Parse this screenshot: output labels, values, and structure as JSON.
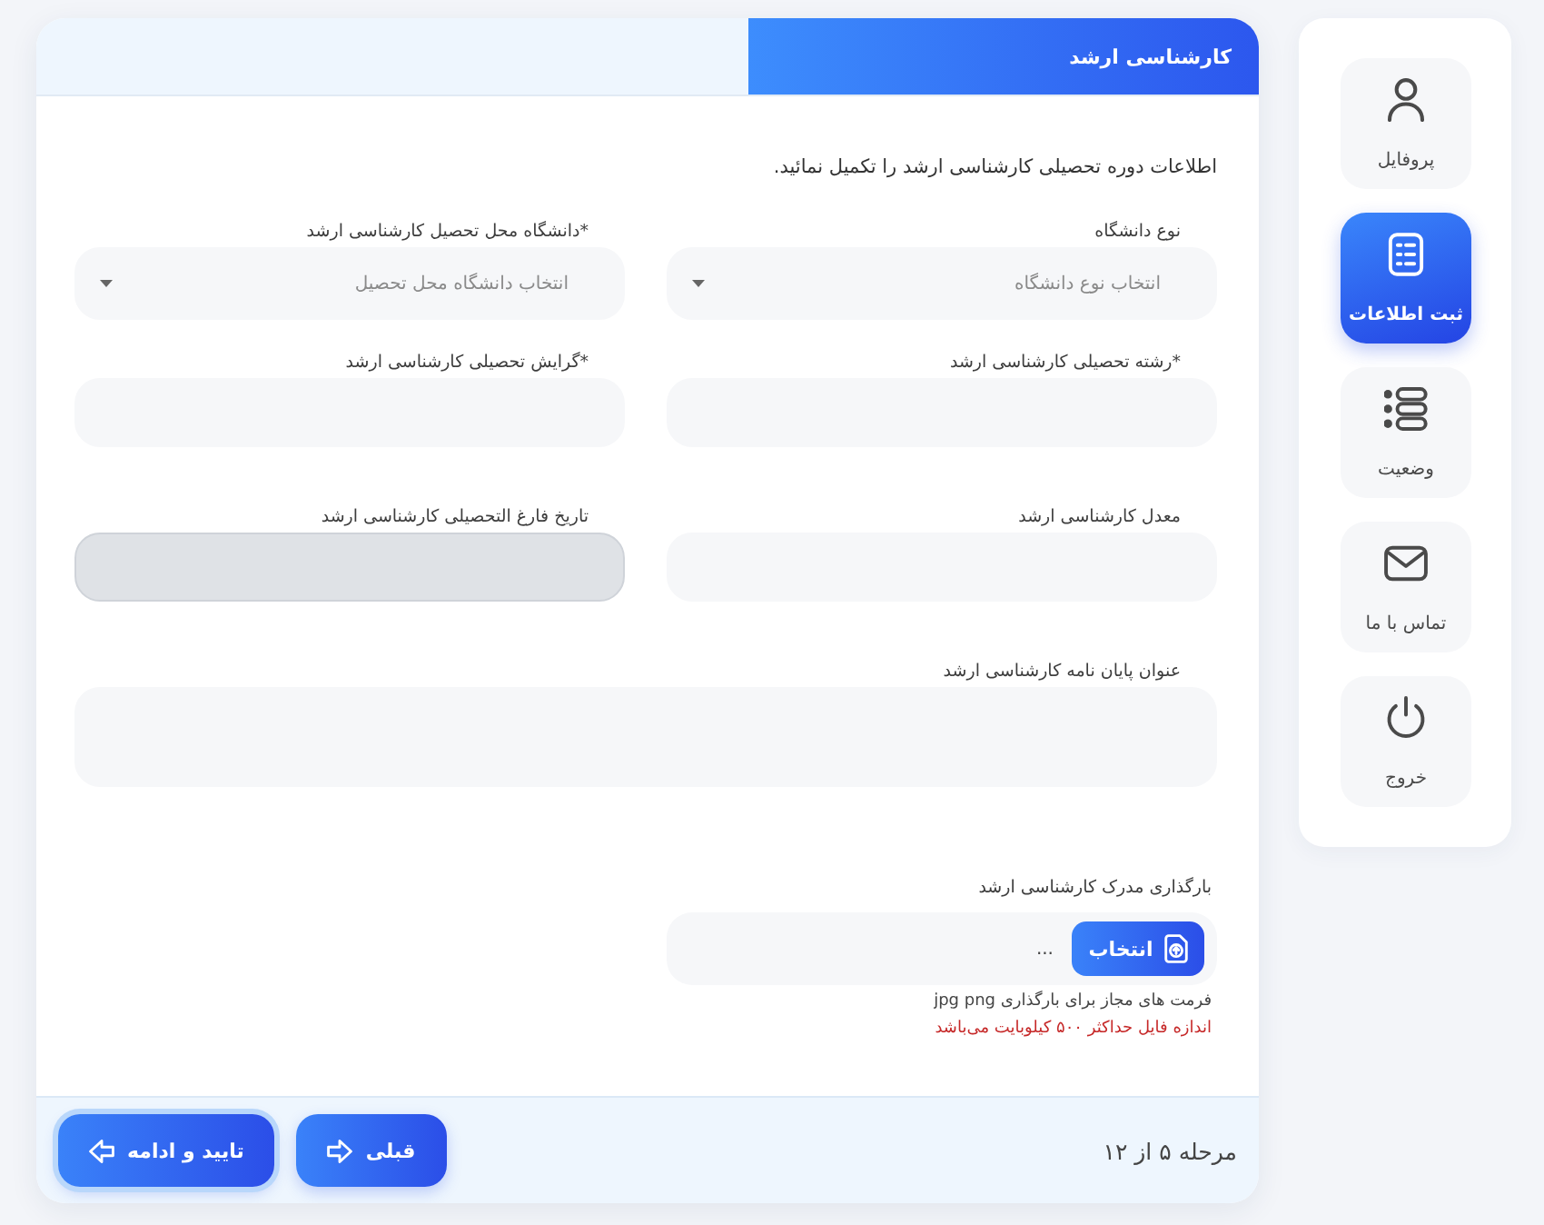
{
  "sidebar": {
    "items": [
      {
        "label": "پروفایل",
        "selected": false
      },
      {
        "label": "ثبت اطلاعات",
        "selected": true
      },
      {
        "label": "وضعیت",
        "selected": false
      },
      {
        "label": "تماس با ما",
        "selected": false
      },
      {
        "label": "خروج",
        "selected": false
      }
    ]
  },
  "card": {
    "title": "کارشناسی ارشد",
    "intro": "اطلاعات دوره تحصیلی کارشناسی ارشد را تکمیل نمائید.",
    "rows": [
      {
        "fields": [
          {
            "kind": "select",
            "label": "نوع دانشگاه",
            "placeholder": "انتخاب نوع دانشگاه",
            "disabled": false
          },
          {
            "kind": "select",
            "label": "*دانشگاه محل تحصیل کارشناسی ارشد",
            "placeholder": "انتخاب دانشگاه محل تحصیل",
            "disabled": false
          }
        ]
      },
      {
        "fields": [
          {
            "kind": "text",
            "label": "*رشته تحصیلی کارشناسی ارشد",
            "disabled": false
          },
          {
            "kind": "text",
            "label": "*گرایش تحصیلی کارشناسی ارشد",
            "disabled": false
          }
        ]
      },
      {
        "fields": [
          {
            "kind": "text",
            "label": "معدل کارشناسی ارشد",
            "disabled": false
          },
          {
            "kind": "text",
            "label": "تاریخ فارغ التحصیلی کارشناسی ارشد",
            "disabled": true
          }
        ]
      },
      {
        "fields": [
          {
            "kind": "textarea",
            "label": "عنوان پایان نامه کارشناسی ارشد",
            "disabled": false
          }
        ]
      }
    ],
    "upload": {
      "label": "بارگذاری مدرک کارشناسی ارشد",
      "button": "انتخاب",
      "file_name": "...",
      "formats": "فرمت های مجاز برای بارگذاری jpg png",
      "size_note": "اندازه فایل حداکثر ۵۰۰ کیلوبایت می‌باشد"
    },
    "footer": {
      "step": "مرحله ۵ از ۱۲",
      "buttons": [
        {
          "kind": "back",
          "label": "قبلی"
        },
        {
          "kind": "next",
          "label": "تایید و ادامه"
        }
      ]
    }
  }
}
